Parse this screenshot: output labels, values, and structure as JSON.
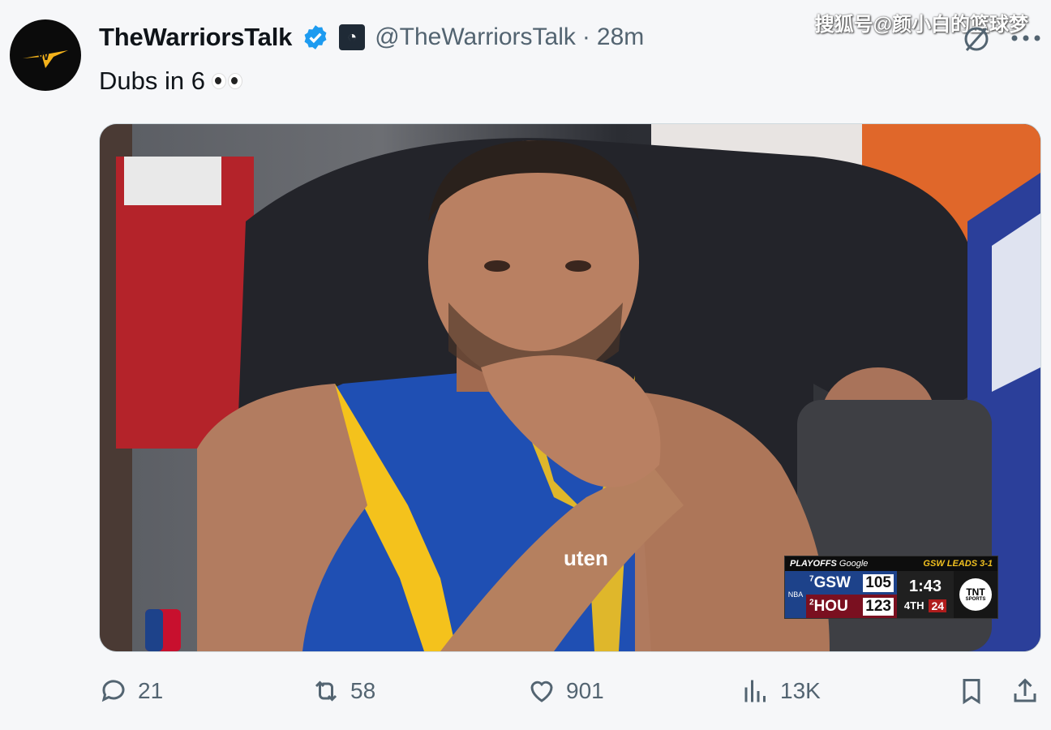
{
  "watermark": "搜狐号@颜小白的篮球梦",
  "tweet": {
    "display_name": "TheWarriorsTalk",
    "handle": "@TheWarriorsTalk",
    "separator": "·",
    "time": "28m",
    "text": "Dubs in 6",
    "avatar_icon": "warriors-talk-logo",
    "verified_icon": "verified-badge",
    "affiliation_icon": "affiliate-badge"
  },
  "media": {
    "jersey_text": "uten",
    "scorebug": {
      "playoffs_label": "PLAYOFFS",
      "sponsor": "Google",
      "leads_text": "GSW LEADS 3-1",
      "home": {
        "seed": "7",
        "team": "GSW",
        "score": "105"
      },
      "away": {
        "seed": "2",
        "team": "HOU",
        "score": "123"
      },
      "clock": "1:43",
      "period": "4TH",
      "shot_clock": "24",
      "network": "TNT",
      "network_sub": "SPORTS"
    }
  },
  "actions": {
    "replies": "21",
    "reposts": "58",
    "likes": "901",
    "views": "13K"
  },
  "colors": {
    "accent_blue": "#1d9bf0",
    "text_secondary": "#536471",
    "gsw_blue": "#1d428a",
    "gsw_gold": "#ffc72c",
    "hou_red": "#7a1020"
  }
}
